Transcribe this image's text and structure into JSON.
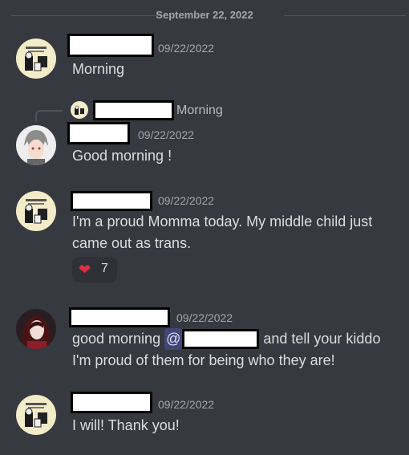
{
  "divider": {
    "date": "September 22, 2022"
  },
  "messages": [
    {
      "time": "09/22/2022",
      "lines": [
        "Morning"
      ]
    },
    {
      "reply": {
        "preview": "Morning"
      },
      "time": "09/22/2022",
      "lines": [
        "Good morning !"
      ]
    },
    {
      "time": "09/22/2022",
      "lines": [
        "I'm a proud Momma today. My middle child just",
        "came out as trans."
      ],
      "reaction": {
        "emoji": "❤",
        "count": "7"
      }
    },
    {
      "time": "09/22/2022",
      "line1_before": "good morning ",
      "mention_at": "@",
      "line1_after": " and tell your kiddo",
      "line2": "I'm proud of them for being who they are!"
    },
    {
      "time": "09/22/2022",
      "lines": [
        "I will! Thank you!"
      ]
    }
  ],
  "colors": {
    "background": "#36393f",
    "text": "#dcddde",
    "muted": "#a3a6aa",
    "mention": "#414675",
    "reaction": "#2f3136"
  }
}
